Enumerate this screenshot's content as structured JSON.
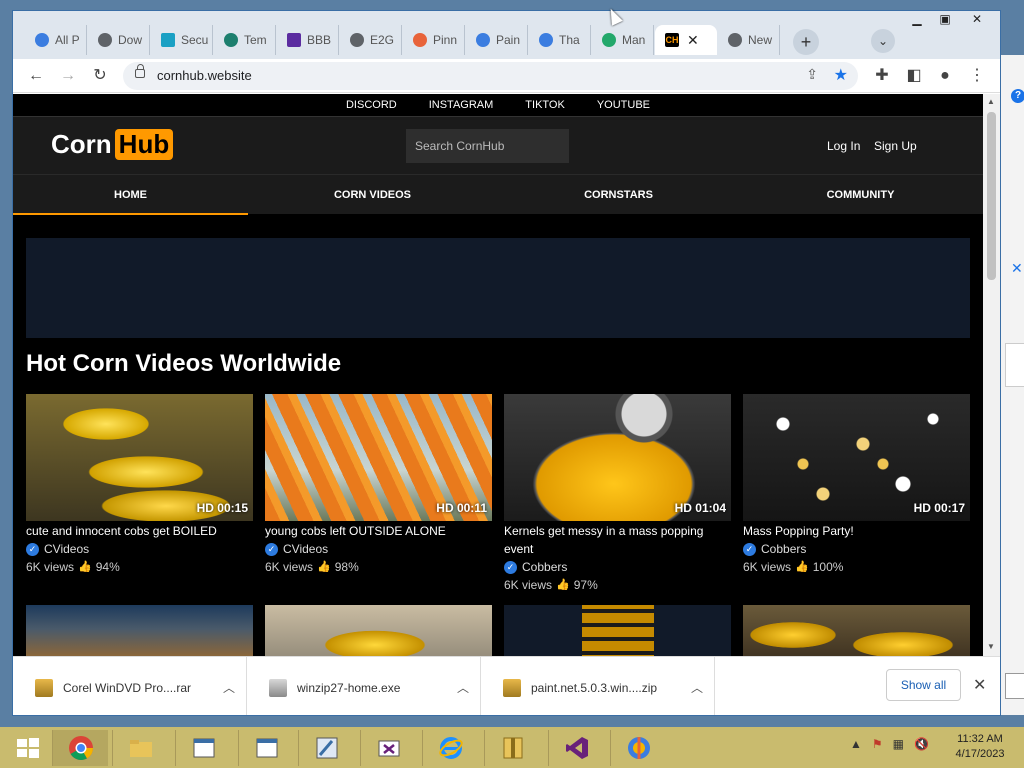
{
  "browser": {
    "tabs": [
      {
        "label": "All P",
        "color": "#3b7de0"
      },
      {
        "label": "Dow",
        "color": "#5f6368"
      },
      {
        "label": "Secu",
        "color": "#1aa0c4"
      },
      {
        "label": "Tem",
        "color": "#1d7f6e"
      },
      {
        "label": "BBB",
        "color": "#5b2ca0"
      },
      {
        "label": "E2G",
        "color": "#5f6368"
      },
      {
        "label": "Pinn",
        "color": "#e8633a"
      },
      {
        "label": "Pain",
        "color": "#3b7de0"
      },
      {
        "label": "Tha",
        "color": "#3b7de0"
      },
      {
        "label": "Man",
        "color": "#23a86b"
      },
      {
        "label": "",
        "favicon": "CH",
        "active": true
      },
      {
        "label": "New",
        "color": "#5f6368"
      }
    ],
    "url": "cornhub.website"
  },
  "site": {
    "social": [
      "DISCORD",
      "INSTAGRAM",
      "TIKTOK",
      "YOUTUBE"
    ],
    "logo_part1": "Corn",
    "logo_part2": "Hub",
    "search_placeholder": "Search CornHub",
    "login": "Log In",
    "signup": "Sign Up",
    "nav": [
      "HOME",
      "CORN VIDEOS",
      "CORNSTARS",
      "COMMUNITY"
    ],
    "section_title": "Hot Corn Videos Worldwide",
    "videos": [
      {
        "duration": "HD 00:15",
        "title": "cute and innocent cobs get BOILED",
        "channel": "CVideos",
        "views": "6K views",
        "rating": "94%"
      },
      {
        "duration": "HD 00:11",
        "title": "young cobs left OUTSIDE ALONE",
        "channel": "CVideos",
        "views": "6K views",
        "rating": "98%"
      },
      {
        "duration": "HD 01:04",
        "title": "Kernels get messy in a mass popping event",
        "channel": "Cobbers",
        "views": "6K views",
        "rating": "97%"
      },
      {
        "duration": "HD 00:17",
        "title": "Mass Popping Party!",
        "channel": "Cobbers",
        "views": "6K views",
        "rating": "100%"
      }
    ]
  },
  "downloads": {
    "items": [
      "Corel WinDVD Pro....rar",
      "winzip27-home.exe",
      "paint.net.5.0.3.win....zip"
    ],
    "show_all": "Show all"
  },
  "taskbar": {
    "time": "11:32 AM",
    "date": "4/17/2023"
  }
}
